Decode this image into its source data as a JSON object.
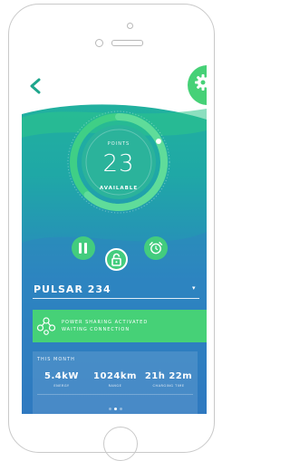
{
  "charger": {
    "points_label": "POINTS",
    "points_value": "23",
    "status": "AVAILABLE",
    "gauge_fill": 0.62
  },
  "station": {
    "name": "PULSAR 234",
    "dropdown_icon": "chevron-down-icon"
  },
  "banner": {
    "line1": "POWER SHARING ACTIVATED",
    "line2": "WAITING CONNECTION"
  },
  "stats": {
    "title": "THIS MONTH",
    "items": [
      {
        "value": "5.4kW",
        "label": "ENERGY"
      },
      {
        "value": "1024km",
        "label": "RANGE"
      },
      {
        "value": "21h 22m",
        "label": "CHARGING TIME"
      }
    ],
    "page_count": 3,
    "active_page": 1
  },
  "colors": {
    "accent": "#46d177",
    "teal": "#22b59a",
    "blue": "#2e72bf"
  },
  "icons": {
    "back": "chevron-left-icon",
    "settings": "gear-icon",
    "pause": "pause-icon",
    "lock": "padlock-icon",
    "alarm": "alarm-clock-icon",
    "power_sharing": "network-icon"
  }
}
